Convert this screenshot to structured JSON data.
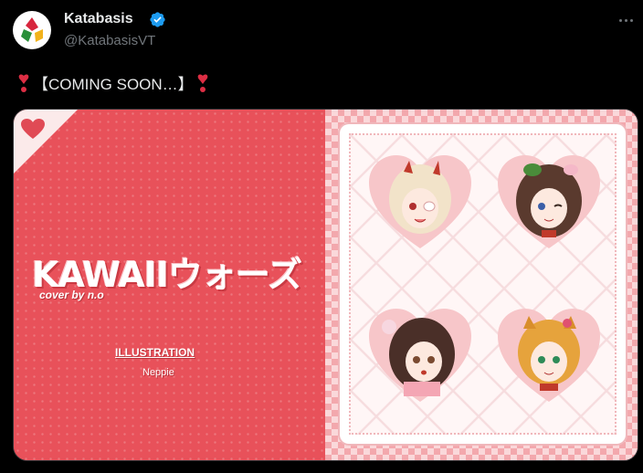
{
  "post": {
    "display_name": "Katabasis",
    "handle": "@KatabasisVT",
    "text": "【COMING SOON…】",
    "verified": true
  },
  "media": {
    "title": "KAWAIIウォーズ",
    "cover_credit": "cover by n.o",
    "illustration_label": "ILLUSTRATION",
    "illustrator": "Neppie"
  },
  "colors": {
    "background": "#000000",
    "text": "#e7e9ea",
    "secondary": "#71767b",
    "verified": "#1d9bf0",
    "media_red": "#e8515a"
  },
  "icons": [
    "verified-badge-icon",
    "more-options-icon",
    "heavy-heart-exclamation-icon",
    "heart-icon"
  ]
}
